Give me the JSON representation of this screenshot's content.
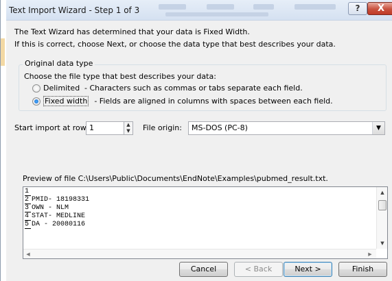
{
  "window": {
    "title": "Text Import Wizard - Step 1 of 3",
    "help_label": "?",
    "close_label": "X"
  },
  "intro": {
    "line1": "The Text Wizard has determined that your data is Fixed Width.",
    "line2": "If this is correct, choose Next, or choose the data type that best describes your data."
  },
  "original_data_type": {
    "legend": "Original data type",
    "prompt": "Choose the file type that best describes your data:",
    "options": [
      {
        "label": "Delimited",
        "description": "- Characters such as commas or tabs separate each field.",
        "checked": false
      },
      {
        "label": "Fixed width",
        "description": "- Fields are aligned in columns with spaces between each field.",
        "checked": true
      }
    ]
  },
  "start_import": {
    "label": "Start import at row:",
    "value": "1"
  },
  "file_origin": {
    "label": "File origin:",
    "value": "MS-DOS (PC-8)"
  },
  "preview": {
    "label": "Preview of file C:\\Users\\Public\\Documents\\EndNote\\Examples\\pubmed_result.txt.",
    "rows": [
      {
        "num": "1",
        "text": ""
      },
      {
        "num": "2",
        "text": "PMID- 18198331"
      },
      {
        "num": "3",
        "text": "OWN - NLM"
      },
      {
        "num": "4",
        "text": "STAT- MEDLINE"
      },
      {
        "num": "5",
        "text": "DA  - 20080116"
      }
    ]
  },
  "buttons": {
    "cancel": "Cancel",
    "back": "< Back",
    "next": "Next >",
    "finish": "Finish"
  }
}
